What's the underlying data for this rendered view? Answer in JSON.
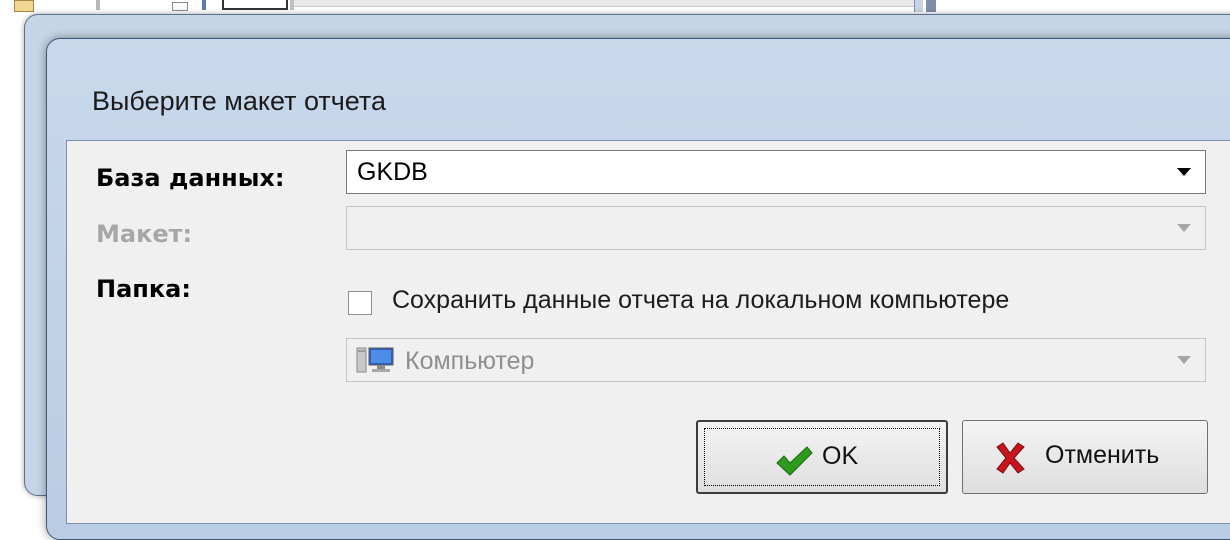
{
  "dialog": {
    "title": "Выберите макет отчета",
    "database": {
      "label": "База данных:",
      "value": "GKDB"
    },
    "layout": {
      "label": "Макет:",
      "value": ""
    },
    "folder": {
      "label": "Папка:",
      "save_locally_label": "Сохранить данные отчета на локальном компьютере",
      "save_locally_checked": false,
      "location": "Компьютер"
    },
    "buttons": {
      "ok": "OK",
      "cancel": "Отменить"
    }
  },
  "icons": {
    "dropdown": "chevron-down-icon",
    "computer": "computer-icon",
    "ok": "checkmark-icon",
    "cancel": "cross-icon"
  },
  "colors": {
    "frame": "#b8cce3",
    "client_background": "#f0f0f0",
    "disabled_text": "#a7a7a7",
    "ok_check": "#2e9a1e",
    "cancel_cross": "#c8141e"
  }
}
